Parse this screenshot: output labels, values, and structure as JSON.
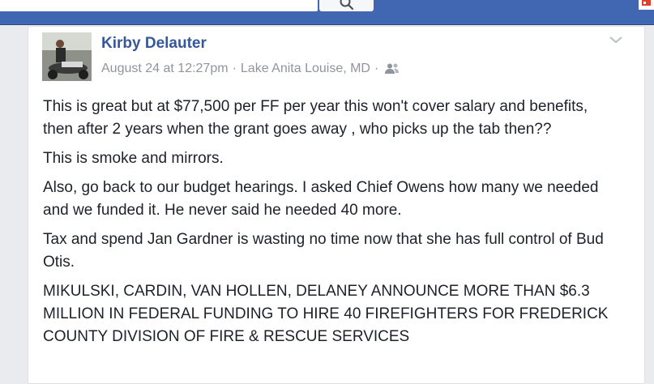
{
  "header": {
    "search_icon": "search-icon",
    "notification_icon": "notification-flag-icon"
  },
  "post": {
    "author": "Kirby Delauter",
    "timestamp": "August 24 at 12:27pm",
    "separator": "·",
    "location": "Lake Anita Louise, MD",
    "audience_icon": "friends-icon",
    "menu_icon": "chevron-down-icon",
    "paragraphs": [
      "This is great but at $77,500 per FF per year this won't cover salary and benefits, then after 2 years when the grant goes away , who picks up the tab then??",
      "This is smoke and mirrors.",
      "Also, go back to our budget hearings. I asked Chief Owens how many we needed and we funded it. He never said he needed 40 more.",
      "Tax and spend Jan Gardner is wasting no time now that she has full control of Bud Otis.",
      "MIKULSKI, CARDIN, VAN HOLLEN, DELANEY ANNOUNCE MORE THAN $6.3 MILLION IN FEDERAL FUNDING TO HIRE 40 FIREFIGHTERS FOR FREDERICK COUNTY DIVISION OF FIRE & RESCUE SERVICES"
    ]
  },
  "colors": {
    "topbar": "#4267b2",
    "author_link": "#365899",
    "meta_text": "#90949c",
    "body_text": "#1d2129",
    "page_bg": "#e9ebee"
  }
}
